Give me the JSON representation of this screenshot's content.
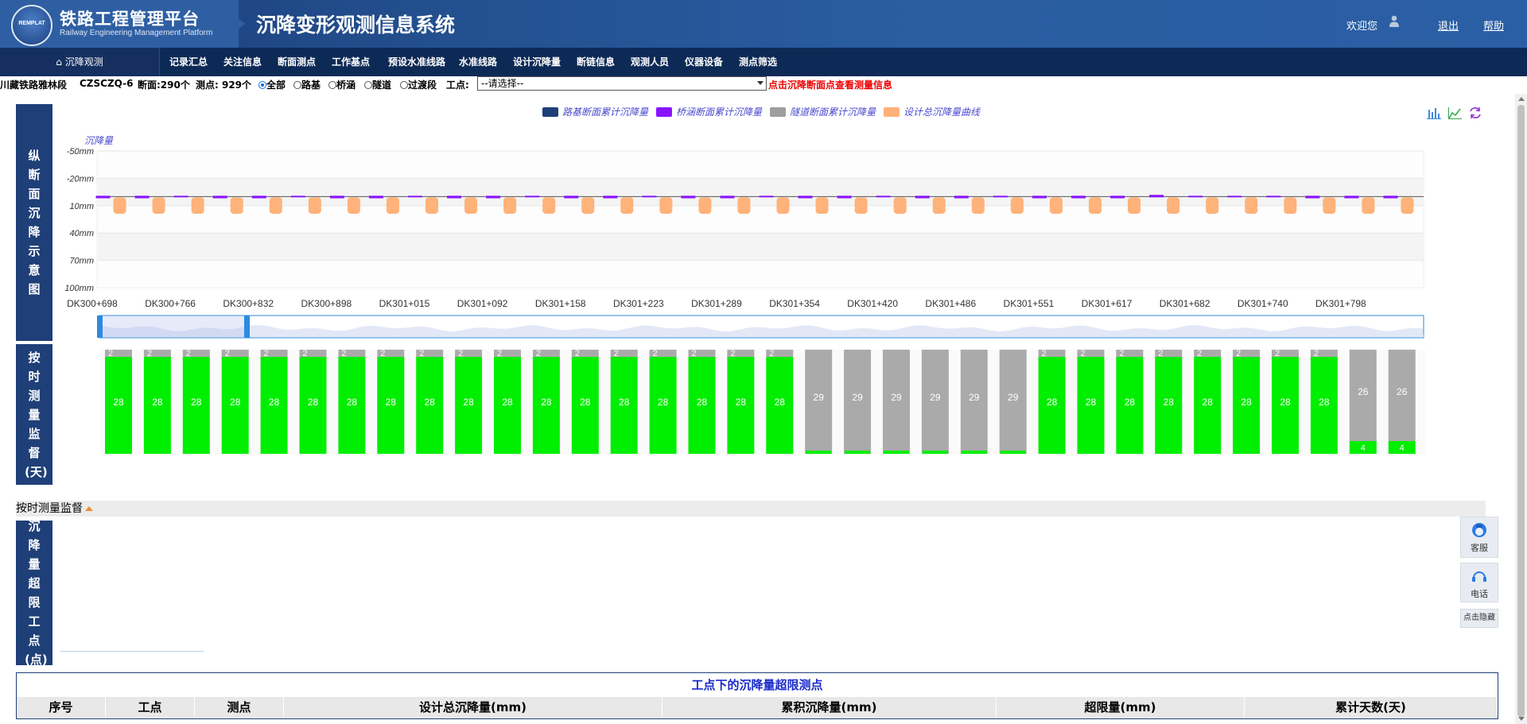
{
  "header": {
    "brand_cn": "铁路工程管理平台",
    "brand_en": "Railway Engineering Management Platform",
    "logo_text": "REMPLAT",
    "system_title": "沉降变形观测信息系统",
    "welcome": "欢迎您",
    "logout": "退出",
    "help": "帮助"
  },
  "nav": {
    "first": "沉降观测",
    "items": [
      "记录汇总",
      "关注信息",
      "断面测点",
      "工作基点",
      "预设水准线路",
      "水准线路",
      "设计沉降量",
      "断链信息",
      "观测人员",
      "仪器设备",
      "测点筛选"
    ]
  },
  "filter": {
    "section": "川藏铁路雅林段",
    "code": "CZSCZQ-6",
    "sections_count": "断面:290个",
    "points_count": "测点: 929个",
    "radios": [
      "全部",
      "路基",
      "桥涵",
      "隧道",
      "过渡段"
    ],
    "selected_radio": "全部",
    "work_point_label": "工点:",
    "select_value": "--请选择--",
    "hint": "点击沉降断面点查看测量信息"
  },
  "labels": {
    "profile": "纵断面沉降示意图",
    "ontime": "按时测量监督(天)",
    "overlimit": "沉降量超限工点(点)",
    "supervise_bar": "按时测量监督"
  },
  "colors": {
    "roadbed": "#1f3f78",
    "bridge": "#8a14ff",
    "tunnel": "#9e9e9e",
    "design": "#ffb27a",
    "ontime_green": "#00ee00",
    "ontime_gray": "#aaaaaa"
  },
  "chart_data": [
    {
      "type": "bar",
      "legend": [
        "路基断面累计沉降量",
        "桥涵断面累计沉降量",
        "隧道断面累计沉降量",
        "设计总沉降量曲线"
      ],
      "ylabel": "沉降量",
      "y_ticks": [
        "-50mm",
        "-20mm",
        "10mm",
        "40mm",
        "70mm",
        "100mm"
      ],
      "ylim": [
        -50,
        100
      ],
      "x_ticks": [
        "DK300+698",
        "DK300+766",
        "DK300+832",
        "DK300+898",
        "DK301+015",
        "DK301+092",
        "DK301+158",
        "DK301+223",
        "DK301+289",
        "DK301+354",
        "DK301+420",
        "DK301+486",
        "DK301+551",
        "DK301+617",
        "DK301+682",
        "DK301+740",
        "DK301+798"
      ],
      "series": [
        {
          "name": "设计总沉降量曲线",
          "values": [
            18,
            18,
            18,
            18,
            18,
            18,
            18,
            18,
            18,
            18,
            18,
            18,
            18,
            18,
            18,
            18,
            18,
            18,
            18,
            18,
            18,
            18,
            18,
            18,
            18,
            18,
            18,
            18,
            18,
            18,
            18,
            18,
            18,
            18
          ]
        },
        {
          "name": "桥涵断面累计沉降量",
          "values": [
            1,
            1,
            0,
            1,
            1,
            0,
            1,
            1,
            0,
            1,
            1,
            0,
            1,
            1,
            0,
            1,
            1,
            0,
            1,
            1,
            0,
            1,
            1,
            0,
            1,
            1,
            1,
            -1,
            0,
            0,
            0,
            1,
            1,
            1
          ]
        }
      ],
      "icons": [
        "bar-chart-icon",
        "line-chart-icon",
        "refresh-icon"
      ]
    },
    {
      "type": "bar",
      "title": "按时测量监督(天)",
      "bars": [
        {
          "top": 2,
          "main": 28,
          "color": "green"
        },
        {
          "top": 2,
          "main": 28,
          "color": "green"
        },
        {
          "top": 2,
          "main": 28,
          "color": "green"
        },
        {
          "top": 2,
          "main": 28,
          "color": "green"
        },
        {
          "top": 2,
          "main": 28,
          "color": "green"
        },
        {
          "top": 2,
          "main": 28,
          "color": "green"
        },
        {
          "top": 2,
          "main": 28,
          "color": "green"
        },
        {
          "top": 2,
          "main": 28,
          "color": "green"
        },
        {
          "top": 2,
          "main": 28,
          "color": "green"
        },
        {
          "top": 2,
          "main": 28,
          "color": "green"
        },
        {
          "top": 2,
          "main": 28,
          "color": "green"
        },
        {
          "top": 2,
          "main": 28,
          "color": "green"
        },
        {
          "top": 2,
          "main": 28,
          "color": "green"
        },
        {
          "top": 2,
          "main": 28,
          "color": "green"
        },
        {
          "top": 2,
          "main": 28,
          "color": "green"
        },
        {
          "top": 2,
          "main": 28,
          "color": "green"
        },
        {
          "top": 2,
          "main": 28,
          "color": "green"
        },
        {
          "top": 2,
          "main": 28,
          "color": "green"
        },
        {
          "main": 29,
          "color": "gray"
        },
        {
          "main": 29,
          "color": "gray"
        },
        {
          "main": 29,
          "color": "gray"
        },
        {
          "main": 29,
          "color": "gray"
        },
        {
          "main": 29,
          "color": "gray"
        },
        {
          "main": 29,
          "color": "gray"
        },
        {
          "top": 2,
          "main": 28,
          "color": "green"
        },
        {
          "top": 2,
          "main": 28,
          "color": "green"
        },
        {
          "top": 2,
          "main": 28,
          "color": "green"
        },
        {
          "top": 2,
          "main": 28,
          "color": "green"
        },
        {
          "top": 2,
          "main": 28,
          "color": "green"
        },
        {
          "top": 2,
          "main": 28,
          "color": "green"
        },
        {
          "top": 2,
          "main": 28,
          "color": "green"
        },
        {
          "top": 2,
          "main": 28,
          "color": "green"
        },
        {
          "main": 26,
          "bottom": 4,
          "color": "gray"
        },
        {
          "main": 26,
          "bottom": 4,
          "color": "gray"
        }
      ]
    }
  ],
  "side": {
    "service": "客服",
    "phone": "电话",
    "hide": "点击隐藏"
  },
  "table": {
    "title": "工点下的沉降量超限测点",
    "headers": [
      "序号",
      "工点",
      "测点",
      "设计总沉降量(mm)",
      "累积沉降量(mm)",
      "超限量(mm)",
      "累计天数(天)"
    ]
  }
}
